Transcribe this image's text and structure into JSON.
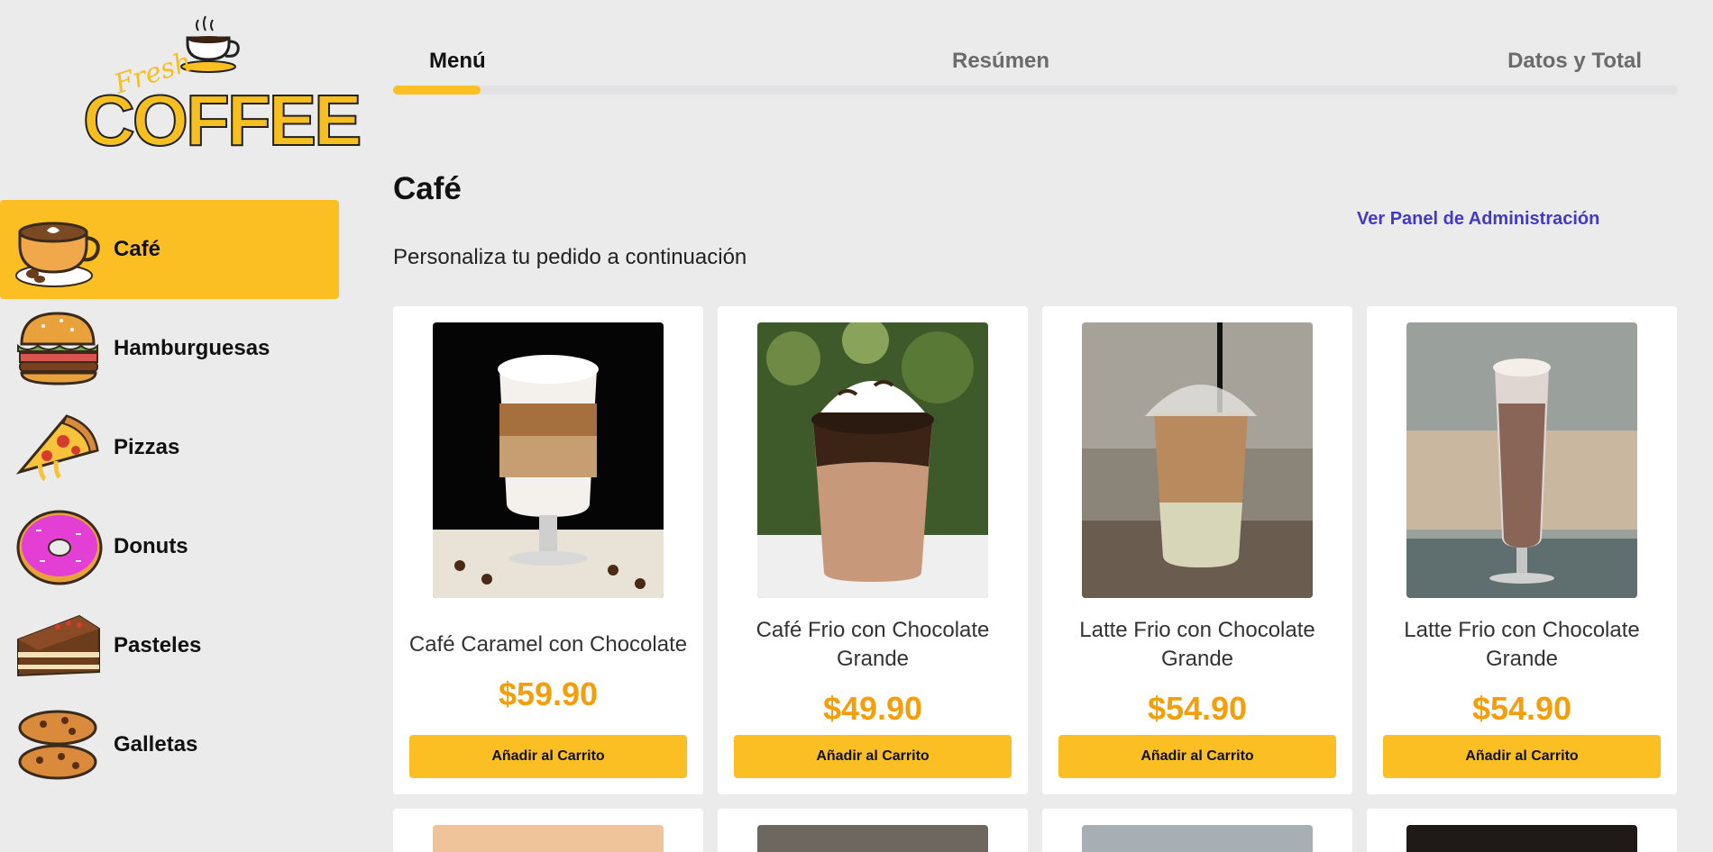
{
  "brand": {
    "fresh": "Fresh",
    "coffee": "COFFEE"
  },
  "categories": [
    {
      "label": "Café",
      "icon": "coffee-cup-icon",
      "active": true
    },
    {
      "label": "Hamburguesas",
      "icon": "burger-icon",
      "active": false
    },
    {
      "label": "Pizzas",
      "icon": "pizza-icon",
      "active": false
    },
    {
      "label": "Donuts",
      "icon": "donut-icon",
      "active": false
    },
    {
      "label": "Pasteles",
      "icon": "cake-icon",
      "active": false
    },
    {
      "label": "Galletas",
      "icon": "cookie-icon",
      "active": false
    }
  ],
  "steps": {
    "items": [
      "Menú",
      "Resúmen",
      "Datos y Total"
    ],
    "active_index": 0,
    "progress_fraction": 0.068
  },
  "page": {
    "heading": "Café",
    "subtitle": "Personaliza tu pedido a continuación",
    "admin_link": "Ver Panel de Administración"
  },
  "products": [
    {
      "name": "Café Caramel con Chocolate",
      "price": "$59.90",
      "button": "Añadir al Carrito"
    },
    {
      "name": "Café Frio con Chocolate Grande",
      "price": "$49.90",
      "button": "Añadir al Carrito"
    },
    {
      "name": "Latte Frio con Chocolate Grande",
      "price": "$54.90",
      "button": "Añadir al Carrito"
    },
    {
      "name": "Latte Frio con Chocolate Grande",
      "price": "$54.90",
      "button": "Añadir al Carrito"
    }
  ],
  "colors": {
    "accent": "#fbbf24",
    "price": "#f59e0b",
    "link": "#4338ca",
    "background": "#ebebeb"
  }
}
